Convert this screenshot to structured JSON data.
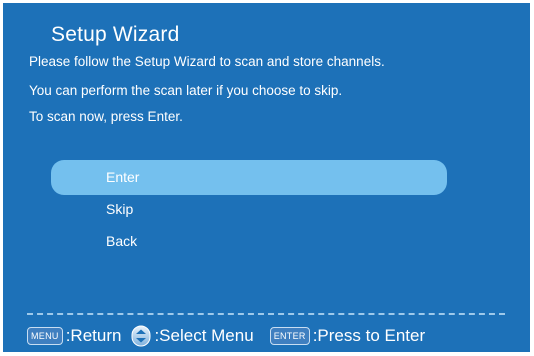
{
  "wizard": {
    "title": "Setup Wizard",
    "lines": [
      "Please follow the Setup Wizard to scan and store channels.",
      "You can perform the scan later if you choose to skip.",
      "To scan now, press Enter."
    ]
  },
  "menu": {
    "items": [
      {
        "label": "Enter",
        "selected": true
      },
      {
        "label": "Skip",
        "selected": false
      },
      {
        "label": "Back",
        "selected": false
      }
    ]
  },
  "footer": {
    "menu_key": "MENU",
    "menu_hint": ":Return",
    "nav_icon": "up-down-arrows-icon",
    "nav_hint": ":Select Menu",
    "enter_key": "ENTER",
    "enter_hint": ":Press to Enter"
  },
  "colors": {
    "background": "#1d71b8",
    "highlight": "#74c0ee",
    "text": "#ffffff"
  }
}
